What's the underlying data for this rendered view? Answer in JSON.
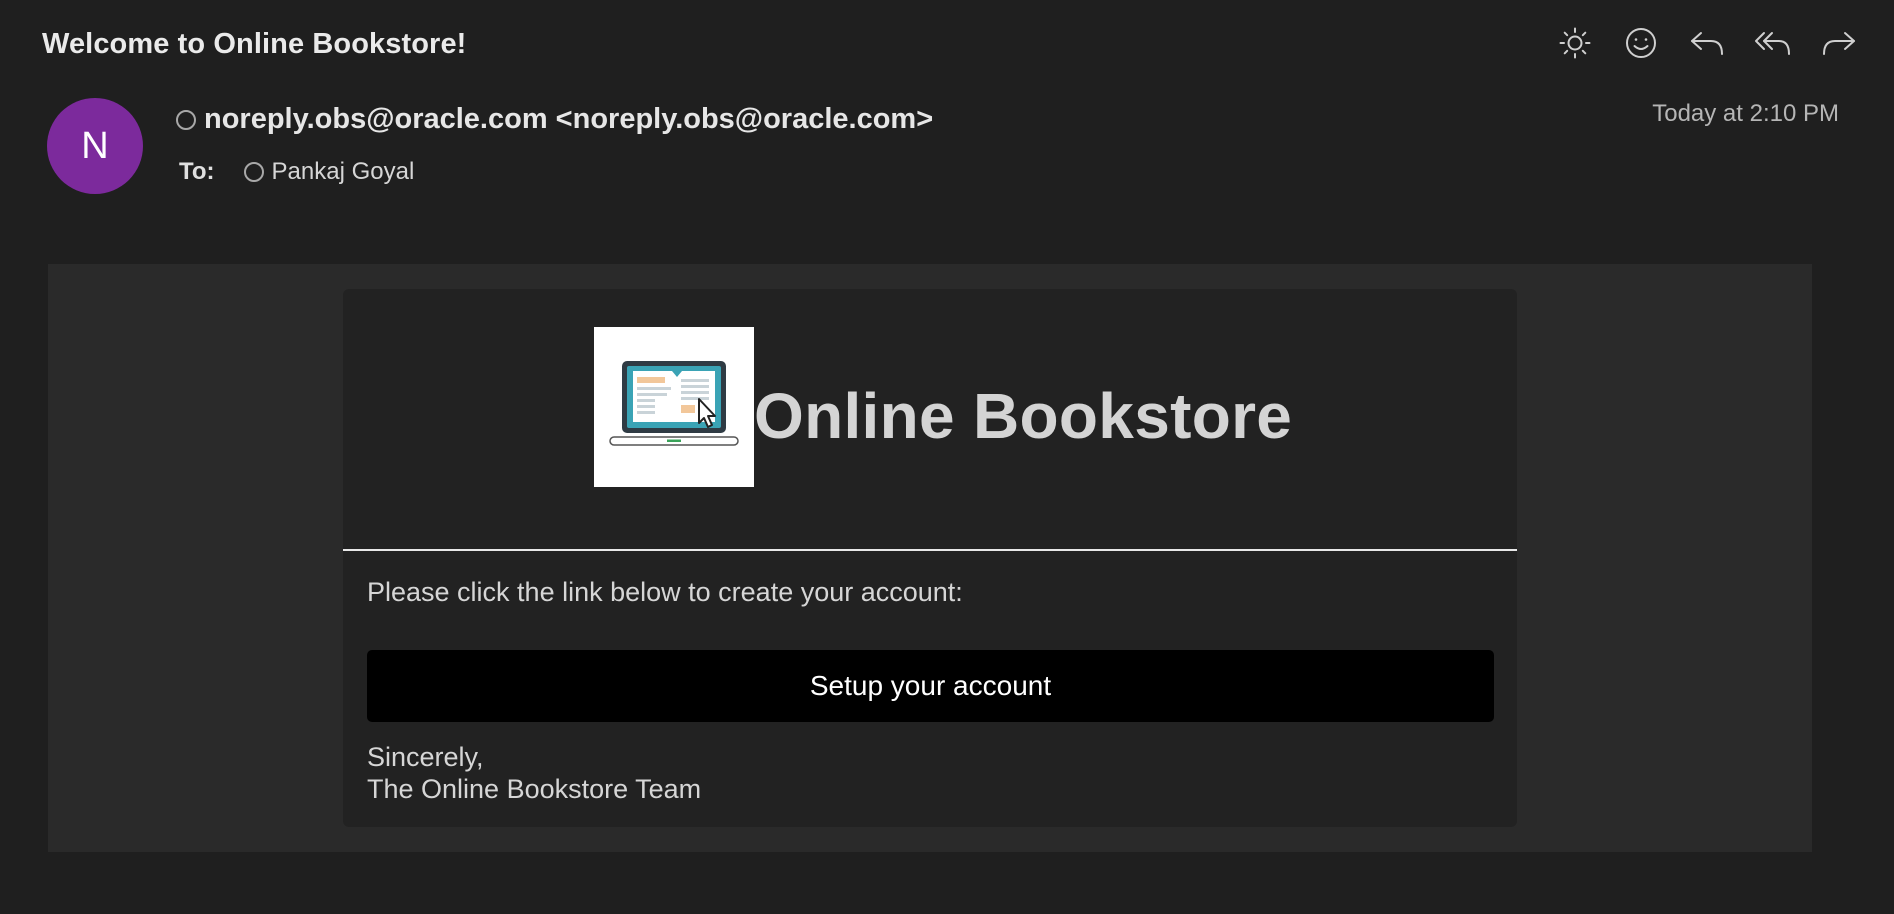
{
  "email": {
    "subject": "Welcome to Online Bookstore!",
    "toolbar": [
      {
        "name": "brightness-icon",
        "label": "Brightness"
      },
      {
        "name": "emoji-icon",
        "label": "Reactions"
      },
      {
        "name": "reply-icon",
        "label": "Reply"
      },
      {
        "name": "reply-all-icon",
        "label": "Reply All"
      },
      {
        "name": "forward-icon",
        "label": "Forward"
      }
    ],
    "avatar_initial": "N",
    "avatar_color": "#7c2a9c",
    "from": "noreply.obs@oracle.com <noreply.obs@oracle.com>",
    "to_label": "To:",
    "to_recipient": "Pankaj Goyal",
    "date": "Today at 2:10 PM"
  },
  "content": {
    "brand_name": "Online Bookstore",
    "logo_icon": "laptop-bookstore-logo",
    "instructions": "Please click the link below to create your account:",
    "button_label": "Setup your account",
    "signoff_line1": "Sincerely,",
    "signoff_line2": "The Online Bookstore Team"
  },
  "colors": {
    "background": "#1f1f1f",
    "body_background": "#2a2a2a",
    "card_background": "#222222",
    "button_background": "#000000",
    "logo_screen": "#3aa3b5",
    "logo_accent": "#f2c79a"
  }
}
